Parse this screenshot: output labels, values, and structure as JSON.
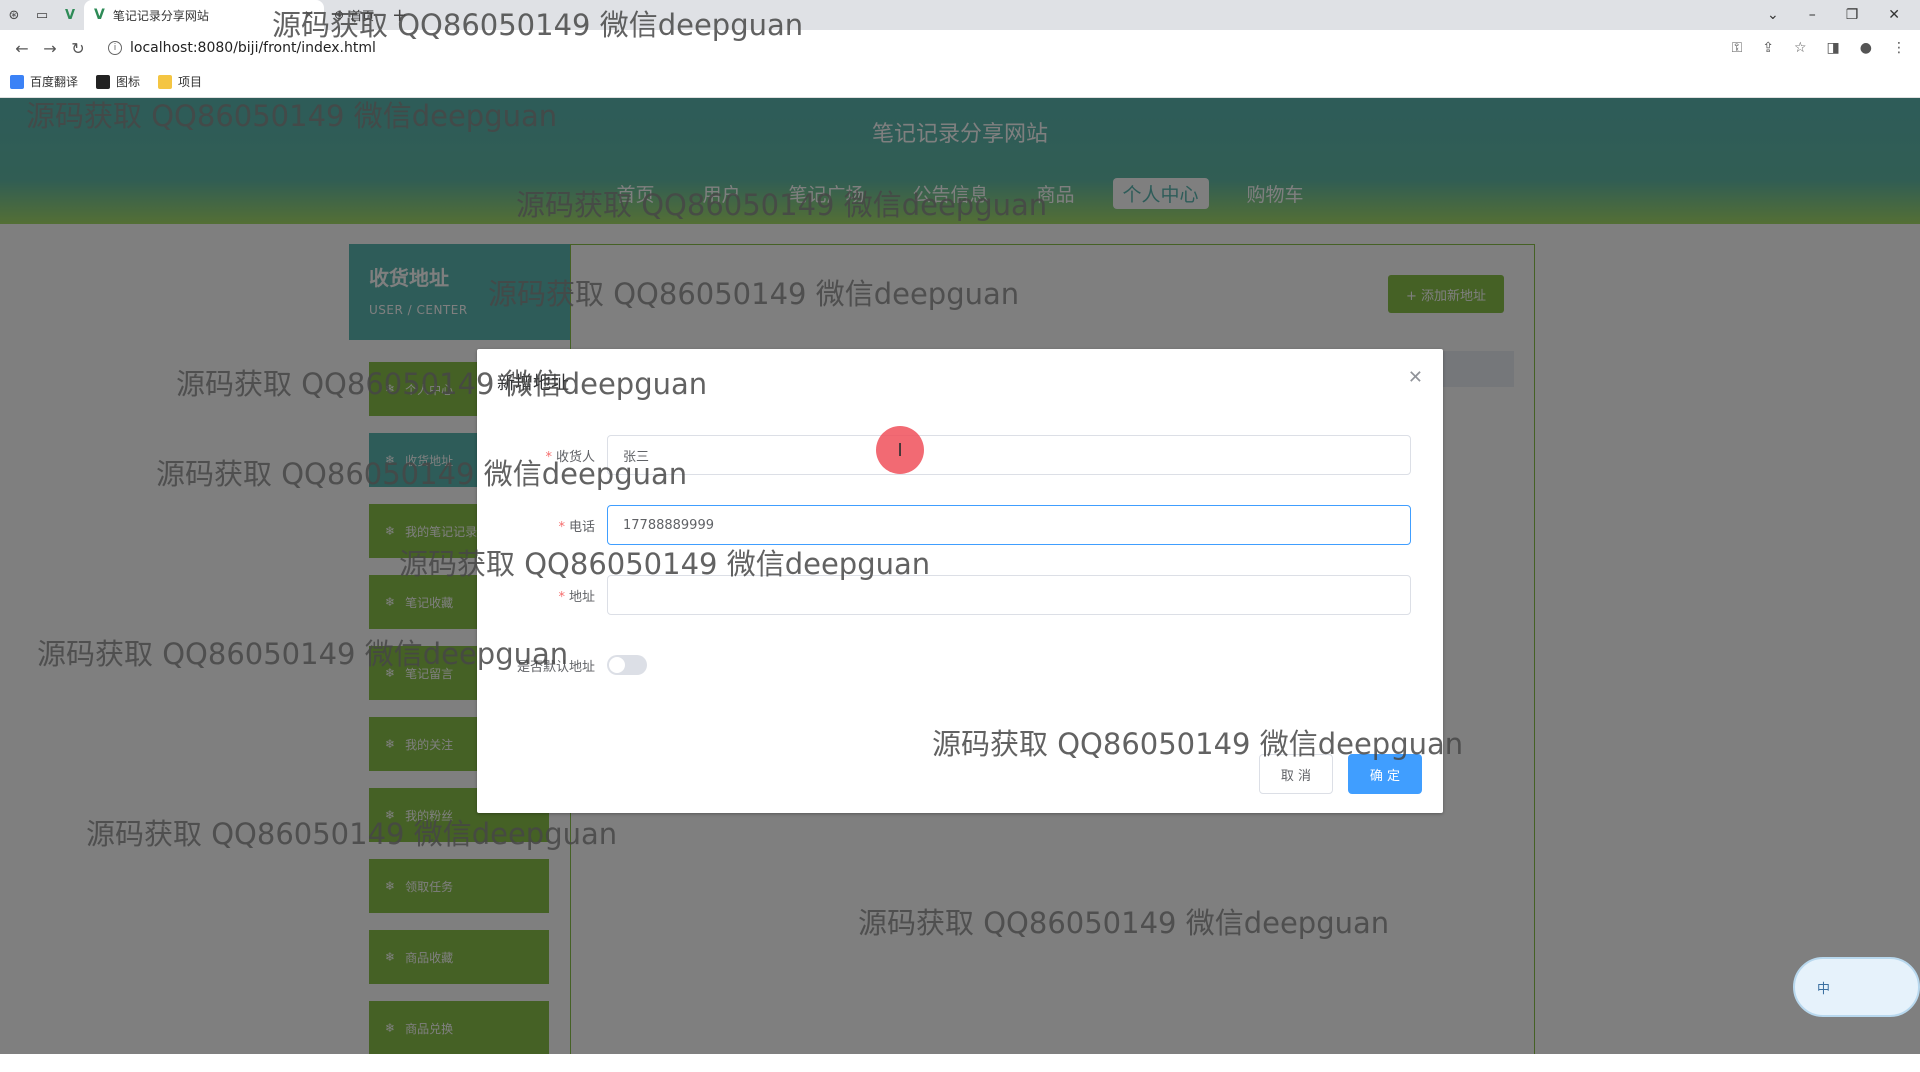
{
  "browser": {
    "tab_label": "笔记记录分享网站",
    "tab2_label": "首页",
    "url": "localhost:8080/biji/front/index.html",
    "bookmarks": [
      "百度翻译",
      "图标",
      "项目"
    ]
  },
  "site": {
    "title": "笔记记录分享网站",
    "nav": [
      "首页",
      "用户",
      "笔记广场",
      "公告信息",
      "商品",
      "个人中心",
      "购物车"
    ]
  },
  "sidebar": {
    "title": "收货地址",
    "subtitle": "USER / CENTER",
    "items": [
      "个人中心",
      "收货地址",
      "我的笔记记录",
      "笔记收藏",
      "笔记留言",
      "我的关注",
      "我的粉丝",
      "领取任务",
      "商品收藏",
      "商品兑换"
    ]
  },
  "content": {
    "add_button": "+ 添加新地址"
  },
  "dialog": {
    "title": "新增地址",
    "fields": {
      "receiver": {
        "label": "收货人",
        "value": "张三"
      },
      "phone": {
        "label": "电话",
        "value": "17788889999"
      },
      "address": {
        "label": "地址",
        "value": ""
      },
      "default": {
        "label": "是否默认地址"
      }
    },
    "cancel": "取 消",
    "confirm": "确 定"
  },
  "watermark": "源码获取 QQ86050149 微信deepguan",
  "ime": {
    "label": "中"
  }
}
